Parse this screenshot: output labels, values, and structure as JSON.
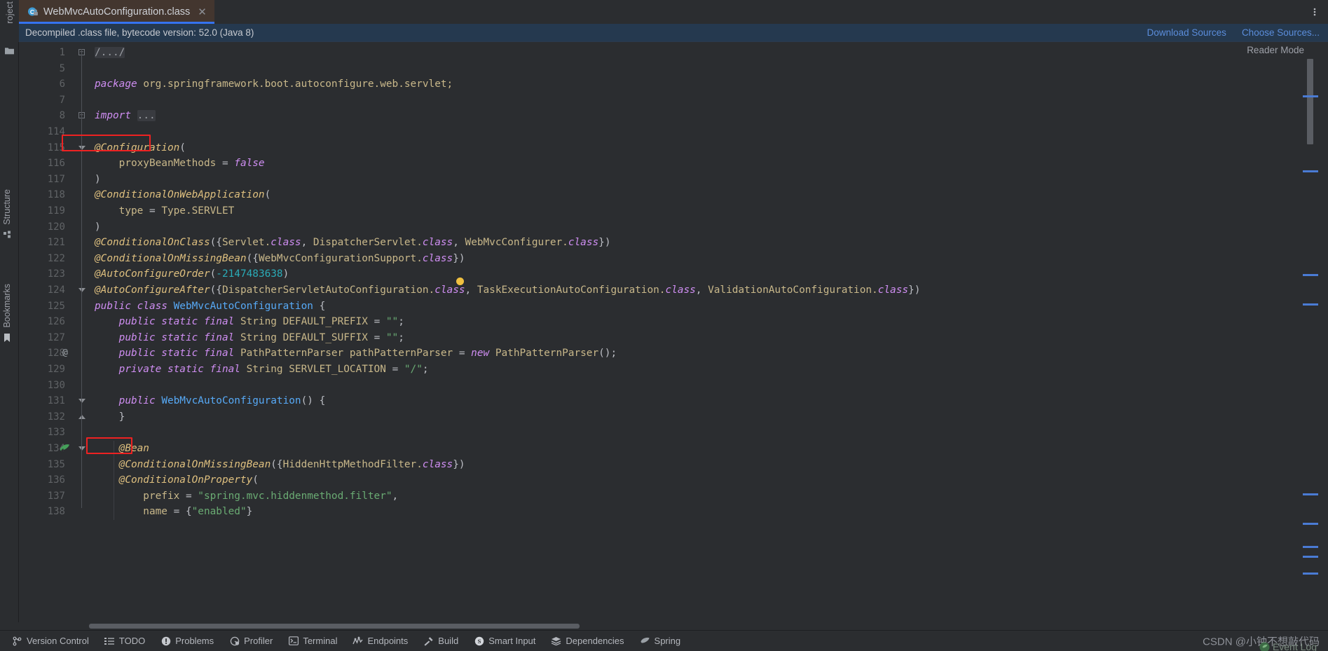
{
  "window": {
    "menu_icon": "more-vertical-icon"
  },
  "tab": {
    "icon": "java-class-locked-icon",
    "title": "WebMvcAutoConfiguration.class",
    "close_icon": "close-icon"
  },
  "banner": {
    "text": "Decompiled .class file, bytecode version: 52.0 (Java 8)",
    "links": [
      {
        "label": "Download Sources",
        "name": "download-sources-link"
      },
      {
        "label": "Choose Sources...",
        "name": "choose-sources-link"
      }
    ],
    "bg": "#25394f",
    "link_color": "#5b8ddb"
  },
  "left_rail": {
    "top_label": "Project",
    "top_icon": "project-folder-icon",
    "groups": [
      {
        "label": "Structure",
        "icon": "structure-icon"
      },
      {
        "label": "Bookmarks",
        "icon": "bookmark-icon"
      }
    ]
  },
  "editor": {
    "reader_mode": "Reader Mode",
    "gutter_icon_line_134": "spring-bean-gutter-icon",
    "gutter_at_marker_line_128": "@",
    "lines": [
      {
        "n": "1",
        "indent": 0,
        "fold": "plus",
        "tokens": [
          {
            "t": "/.../",
            "c": "fold-ph"
          }
        ]
      },
      {
        "n": "5",
        "indent": 0,
        "tokens": []
      },
      {
        "n": "6",
        "indent": 0,
        "tokens": [
          {
            "t": "package",
            "c": "kw"
          },
          {
            "t": " ",
            "c": "plain"
          },
          {
            "t": "org.springframework.boot.autoconfigure.web.servlet;",
            "c": "ident"
          }
        ]
      },
      {
        "n": "7",
        "indent": 0,
        "tokens": []
      },
      {
        "n": "8",
        "indent": 0,
        "fold": "plus",
        "tokens": [
          {
            "t": "import",
            "c": "kw"
          },
          {
            "t": " ",
            "c": "plain"
          },
          {
            "t": "...",
            "c": "fold-ph"
          }
        ]
      },
      {
        "n": "114",
        "indent": 0,
        "tokens": []
      },
      {
        "n": "115",
        "indent": 0,
        "fold": "start",
        "tokens": [
          {
            "t": "@Configuration",
            "c": "anno"
          },
          {
            "t": "(",
            "c": "punct"
          }
        ]
      },
      {
        "n": "116",
        "indent": 0,
        "tokens": [
          {
            "t": "    proxyBeanMethods ",
            "c": "ident"
          },
          {
            "t": "= ",
            "c": "punct"
          },
          {
            "t": "false",
            "c": "kw"
          }
        ]
      },
      {
        "n": "117",
        "indent": 0,
        "tokens": [
          {
            "t": ")",
            "c": "punct"
          }
        ]
      },
      {
        "n": "118",
        "indent": 0,
        "tokens": [
          {
            "t": "@ConditionalOnWebApplication",
            "c": "anno"
          },
          {
            "t": "(",
            "c": "punct"
          }
        ]
      },
      {
        "n": "119",
        "indent": 0,
        "tokens": [
          {
            "t": "    type ",
            "c": "ident"
          },
          {
            "t": "= ",
            "c": "punct"
          },
          {
            "t": "Type.",
            "c": "ident"
          },
          {
            "t": "SERVLET",
            "c": "ident"
          }
        ]
      },
      {
        "n": "120",
        "indent": 0,
        "tokens": [
          {
            "t": ")",
            "c": "punct"
          }
        ]
      },
      {
        "n": "121",
        "indent": 0,
        "tokens": [
          {
            "t": "@ConditionalOnClass",
            "c": "anno"
          },
          {
            "t": "({",
            "c": "punct"
          },
          {
            "t": "Servlet.",
            "c": "ident"
          },
          {
            "t": "class",
            "c": "cls"
          },
          {
            "t": ", ",
            "c": "punct"
          },
          {
            "t": "DispatcherServlet.",
            "c": "ident"
          },
          {
            "t": "class",
            "c": "cls"
          },
          {
            "t": ", ",
            "c": "punct"
          },
          {
            "t": "WebMvcConfigurer.",
            "c": "ident"
          },
          {
            "t": "class",
            "c": "cls"
          },
          {
            "t": "})",
            "c": "punct"
          }
        ]
      },
      {
        "n": "122",
        "indent": 0,
        "tokens": [
          {
            "t": "@ConditionalOnMissingBean",
            "c": "anno"
          },
          {
            "t": "({",
            "c": "punct"
          },
          {
            "t": "WebMvcConfigurationSupport.",
            "c": "ident"
          },
          {
            "t": "class",
            "c": "cls"
          },
          {
            "t": "})",
            "c": "punct"
          }
        ]
      },
      {
        "n": "123",
        "indent": 0,
        "tokens": [
          {
            "t": "@AutoConfigureOrder",
            "c": "anno"
          },
          {
            "t": "(",
            "c": "punct"
          },
          {
            "t": "-2147483638",
            "c": "num"
          },
          {
            "t": ")",
            "c": "punct"
          }
        ]
      },
      {
        "n": "124",
        "indent": 0,
        "fold": "start",
        "tokens": [
          {
            "t": "@AutoConfigureAfter",
            "c": "anno"
          },
          {
            "t": "({",
            "c": "punct"
          },
          {
            "t": "DispatcherServletAutoConfiguration.",
            "c": "ident"
          },
          {
            "t": "class",
            "c": "cls"
          },
          {
            "t": ", ",
            "c": "punct"
          },
          {
            "t": "TaskExecutionAutoConfiguration.",
            "c": "ident"
          },
          {
            "t": "class",
            "c": "cls"
          },
          {
            "t": ", ",
            "c": "punct"
          },
          {
            "t": "ValidationAutoConfiguration.",
            "c": "ident"
          },
          {
            "t": "class",
            "c": "cls"
          },
          {
            "t": "})",
            "c": "punct"
          }
        ]
      },
      {
        "n": "125",
        "indent": 0,
        "tokens": [
          {
            "t": "public class ",
            "c": "kw"
          },
          {
            "t": "WebMvcAutoConfiguration",
            "c": "method"
          },
          {
            "t": " {",
            "c": "punct"
          }
        ]
      },
      {
        "n": "126",
        "indent": 0,
        "tokens": [
          {
            "t": "    ",
            "c": "plain"
          },
          {
            "t": "public static final ",
            "c": "kw"
          },
          {
            "t": "String ",
            "c": "type"
          },
          {
            "t": "DEFAULT_PREFIX ",
            "c": "ident"
          },
          {
            "t": "= ",
            "c": "punct"
          },
          {
            "t": "\"\"",
            "c": "str"
          },
          {
            "t": ";",
            "c": "punct"
          }
        ]
      },
      {
        "n": "127",
        "indent": 0,
        "tokens": [
          {
            "t": "    ",
            "c": "plain"
          },
          {
            "t": "public static final ",
            "c": "kw"
          },
          {
            "t": "String ",
            "c": "type"
          },
          {
            "t": "DEFAULT_SUFFIX ",
            "c": "ident"
          },
          {
            "t": "= ",
            "c": "punct"
          },
          {
            "t": "\"\"",
            "c": "str"
          },
          {
            "t": ";",
            "c": "punct"
          }
        ]
      },
      {
        "n": "128",
        "indent": 0,
        "at": true,
        "tokens": [
          {
            "t": "    ",
            "c": "plain"
          },
          {
            "t": "public static final ",
            "c": "kw"
          },
          {
            "t": "PathPatternParser ",
            "c": "type"
          },
          {
            "t": "pathPatternParser ",
            "c": "ident"
          },
          {
            "t": "= ",
            "c": "punct"
          },
          {
            "t": "new ",
            "c": "kw"
          },
          {
            "t": "PathPatternParser",
            "c": "type"
          },
          {
            "t": "();",
            "c": "punct"
          }
        ]
      },
      {
        "n": "129",
        "indent": 0,
        "tokens": [
          {
            "t": "    ",
            "c": "plain"
          },
          {
            "t": "private static final ",
            "c": "kw"
          },
          {
            "t": "String ",
            "c": "type"
          },
          {
            "t": "SERVLET_LOCATION ",
            "c": "ident"
          },
          {
            "t": "= ",
            "c": "punct"
          },
          {
            "t": "\"/\"",
            "c": "str"
          },
          {
            "t": ";",
            "c": "punct"
          }
        ]
      },
      {
        "n": "130",
        "indent": 0,
        "tokens": []
      },
      {
        "n": "131",
        "indent": 0,
        "fold": "start",
        "tokens": [
          {
            "t": "    ",
            "c": "plain"
          },
          {
            "t": "public ",
            "c": "kw"
          },
          {
            "t": "WebMvcAutoConfiguration",
            "c": "method"
          },
          {
            "t": "() {",
            "c": "punct"
          }
        ]
      },
      {
        "n": "132",
        "indent": 0,
        "fold": "end",
        "tokens": [
          {
            "t": "    }",
            "c": "punct"
          }
        ]
      },
      {
        "n": "133",
        "indent": 0,
        "tokens": []
      },
      {
        "n": "134",
        "indent": 0,
        "fold": "start",
        "bean": true,
        "tokens": [
          {
            "t": "    ",
            "c": "plain"
          },
          {
            "t": "@Bean",
            "c": "anno"
          }
        ]
      },
      {
        "n": "135",
        "indent": 0,
        "tokens": [
          {
            "t": "    ",
            "c": "plain"
          },
          {
            "t": "@ConditionalOnMissingBean",
            "c": "anno"
          },
          {
            "t": "({",
            "c": "punct"
          },
          {
            "t": "HiddenHttpMethodFilter.",
            "c": "ident"
          },
          {
            "t": "class",
            "c": "cls"
          },
          {
            "t": "})",
            "c": "punct"
          }
        ]
      },
      {
        "n": "136",
        "indent": 0,
        "tokens": [
          {
            "t": "    ",
            "c": "plain"
          },
          {
            "t": "@ConditionalOnProperty",
            "c": "anno"
          },
          {
            "t": "(",
            "c": "punct"
          }
        ]
      },
      {
        "n": "137",
        "indent": 0,
        "tokens": [
          {
            "t": "        prefix ",
            "c": "ident"
          },
          {
            "t": "= ",
            "c": "punct"
          },
          {
            "t": "\"spring.mvc.hiddenmethod.filter\"",
            "c": "str"
          },
          {
            "t": ",",
            "c": "punct"
          }
        ]
      },
      {
        "n": "138",
        "indent": 0,
        "tokens": [
          {
            "t": "        name ",
            "c": "ident"
          },
          {
            "t": "= ",
            "c": "punct"
          },
          {
            "t": "{",
            "c": "punct"
          },
          {
            "t": "\"enabled\"",
            "c": "str"
          },
          {
            "t": "}",
            "c": "punct"
          }
        ]
      }
    ],
    "redbox_labels": [
      "@Configuration",
      "@Bean"
    ]
  },
  "statusbar": {
    "items": [
      {
        "label": "Version Control",
        "icon": "branch-icon"
      },
      {
        "label": "TODO",
        "icon": "list-icon"
      },
      {
        "label": "Problems",
        "icon": "warning-circle-icon"
      },
      {
        "label": "Profiler",
        "icon": "profiler-icon"
      },
      {
        "label": "Terminal",
        "icon": "terminal-icon"
      },
      {
        "label": "Endpoints",
        "icon": "endpoints-icon"
      },
      {
        "label": "Build",
        "icon": "hammer-icon"
      },
      {
        "label": "Smart Input",
        "icon": "smart-input-icon"
      },
      {
        "label": "Dependencies",
        "icon": "layers-icon"
      },
      {
        "label": "Spring",
        "icon": "spring-leaf-icon"
      }
    ],
    "watermark": "CSDN @小钟不想敲代码",
    "event_log": {
      "label": "Event Log",
      "icon": "spring-leaf-icon"
    }
  }
}
